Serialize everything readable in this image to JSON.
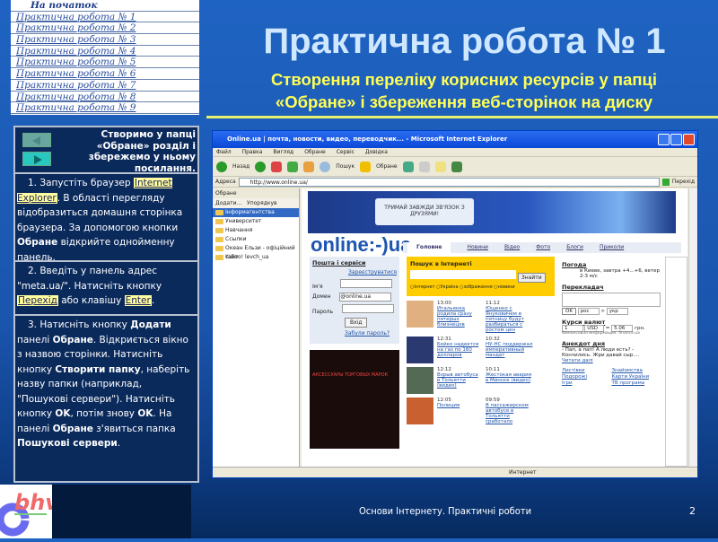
{
  "nav": {
    "home": "На початок",
    "items": [
      "Практична робота № 1",
      "Практична робота № 2",
      "Практична робота № 3",
      "Практична робота № 4",
      "Практична робота № 5",
      "Практична робота № 6",
      "Практична робота № 7",
      "Практична робота № 8",
      "Практична робота № 9"
    ]
  },
  "title": "Практична робота № 1",
  "subtitle": [
    "Створення переліку корисних ресурсів у папці",
    "«Обране» і збереження веб-сторінок на диску"
  ],
  "panel": {
    "intro": "Створимо у папці «Обране» розділ і збережемо у ньому посилання.",
    "step1": {
      "a": "1. Запустіть браузер ",
      "b": "Internet Explorer",
      "c": ". В області перегляду відобразиться домашня сторінка браузера. За допомогою кнопки ",
      "d": "Обране",
      "e": " відкрийте однойменну панель."
    },
    "step2": {
      "a": "2. Введіть у панель адрес \"meta.ua/\". Натисніть кнопку ",
      "b": "Перехід",
      "c": " або клавішу ",
      "d": "Enter",
      "e": "."
    },
    "step3": {
      "a": "3. Натисніть кнопку ",
      "b": "Додати",
      "c": " панелі ",
      "d": "Обране",
      "e": ". Відкриється вікно з назвою сторінки. Натисніть кнопку ",
      "f": "Створити папку",
      "g": ", наберіть назву папки (наприклад, \"Пошукові сервери\"). Натисніть кнопку ",
      "h": "OK",
      "i": ", потім знову ",
      "j": "OK",
      "k": ". На панелі ",
      "l": "Обране",
      "m": " з'явиться папка ",
      "n": "Пошукові сервери",
      "o": "."
    }
  },
  "browser": {
    "title": "Online.ua | почта, новости, видео, переводчик... - Microsoft Internet Explorer",
    "menu": [
      "Файл",
      "Правка",
      "Вигляд",
      "Обране",
      "Сервіс",
      "Довідка"
    ],
    "back": "Назад",
    "search": "Пошук",
    "favorites": "Обране",
    "address_label": "Адреса",
    "address": "http://www.online.ua/",
    "go": "Перехід",
    "fav_panel": {
      "title": "Обране",
      "add": "Додати...",
      "organize": "Упорядкув",
      "items": [
        "Інформагентства",
        "Университет",
        "Навчання",
        "Ссылки",
        "Океан Ельзи - офіційний сайт",
        "Yahoo! levch_ua"
      ]
    },
    "banner": "ТРИМАЙ ЗАВЖДИ ЗВ'ЯЗОК З ДРУЗЯМИ!",
    "logo": "online:-)ua",
    "tabs": [
      "Головне",
      "Новини",
      "Відео",
      "Фото",
      "Блоги",
      "Приколи"
    ],
    "mail": {
      "title": "Пошта і сервіси",
      "register": "Зареєструватися",
      "name": "Ім'я",
      "domain": "Домен",
      "domain_value": "@online.ua",
      "password": "Пароль",
      "login": "Вхід",
      "forgot": "Забули пароль?"
    },
    "search_box": {
      "title": "Пошук в Інтернеті",
      "button": "Знайти",
      "options": [
        "Інтернет",
        "Україна",
        "зображення",
        "новини"
      ]
    },
    "news": [
      {
        "time": "13:00",
        "text": "Итальянка родила сразу пятерых близнецов"
      },
      {
        "time": "11:12",
        "text": "Ющенко с Януковичем в пятницу будут разбираться с ростом цен"
      },
      {
        "time": "12:31",
        "text": "Бойко надеется на газ по 160 долларов"
      },
      {
        "time": "10:32",
        "text": "НУ-НС поддержал императивный мандат"
      },
      {
        "time": "12:12",
        "text": "Взрыв автобуса в Тольятти (видео)"
      },
      {
        "time": "10:11",
        "text": "Жестокая авария в Минске (видео)"
      },
      {
        "time": "12:05",
        "text": "Полиция"
      },
      {
        "time": "09:59",
        "text": "В пассажирском автобусе в Тольятти сработало"
      }
    ],
    "ad_text": "АКСЕССУАРЫ ТОРГОВЫХ МАРОК",
    "weather": {
      "title": "Погода",
      "text": "в Киеве, завтра +4...+6, ветер 2-3 м/с"
    },
    "translator": {
      "title": "Перекладач",
      "ok": "OK",
      "from": "рос",
      "to": "укр"
    },
    "currency": {
      "title": "Курси валют",
      "amount": "1",
      "code": "USD",
      "result": "5.06",
      "unit": "грн.",
      "source": "Финансовая информация: finance.ua"
    },
    "joke": {
      "title": "Анекдот дня",
      "text": "- Пап, а пап! А люди есть? - Кончились. Жри давай сыр....",
      "more": "Читати далі"
    },
    "links": [
      "Листівки",
      "Знайомства",
      "Подорожі",
      "Карти України",
      "Ігри",
      "ТВ програма"
    ],
    "status": "Интернет"
  },
  "footer": {
    "text": "Основи Інтернету. Практичні роботи",
    "page": "2",
    "logo": "bhv"
  }
}
